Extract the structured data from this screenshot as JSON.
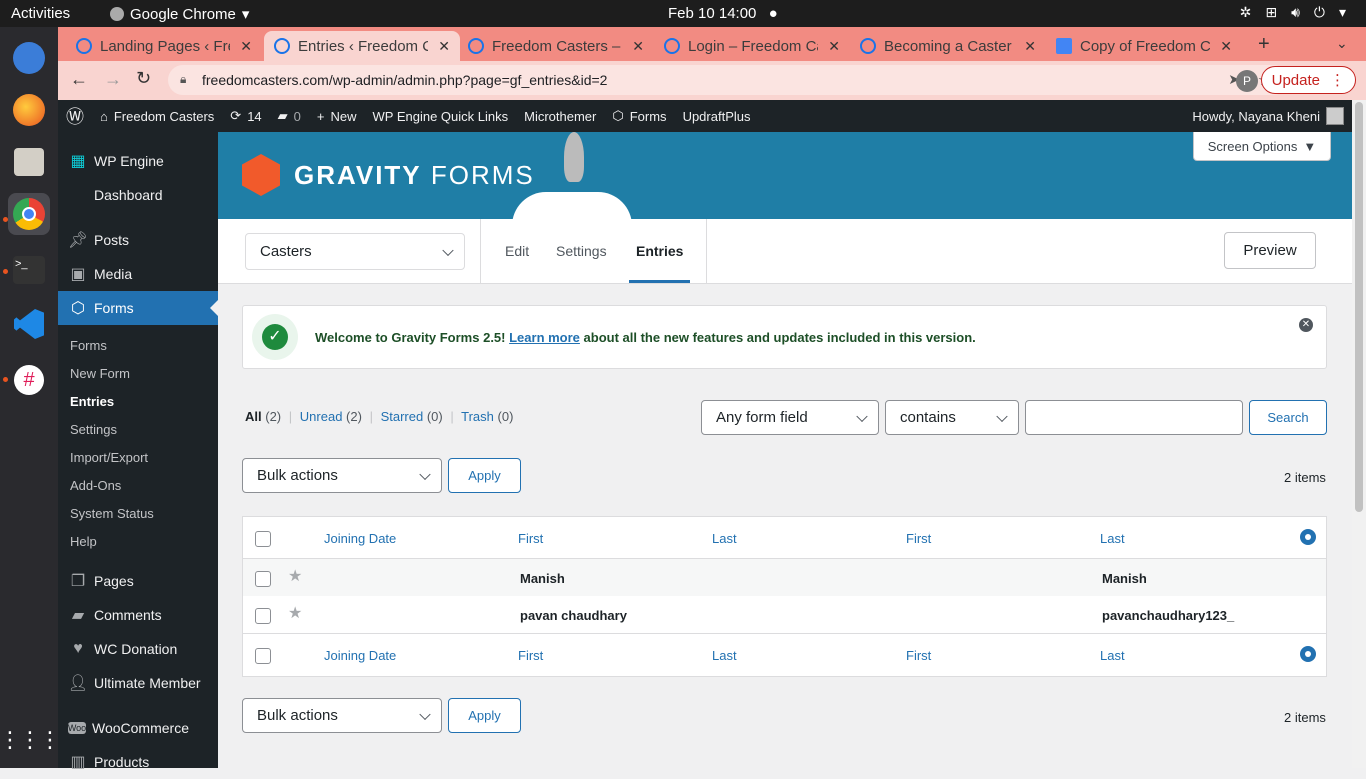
{
  "topbar": {
    "activities": "Activities",
    "app_name": "Google Chrome",
    "clock": "Feb 10  14:00"
  },
  "browser": {
    "tabs": [
      {
        "title": "Landing Pages ‹ Freedom Casters"
      },
      {
        "title": "Entries ‹ Freedom Casters"
      },
      {
        "title": "Freedom Casters – Freedom"
      },
      {
        "title": "Login – Freedom Casters"
      },
      {
        "title": "Becoming a Caster"
      },
      {
        "title": "Copy of Freedom Casters"
      }
    ],
    "url": "freedomcasters.com/wp-admin/admin.php?page=gf_entries&id=2",
    "profile_initial": "P",
    "update_label": "Update"
  },
  "adminbar": {
    "site_name": "Freedom Casters",
    "updates_count": "14",
    "comments_count": "0",
    "new_label": "New",
    "wpengine_links": "WP Engine Quick Links",
    "microthemer": "Microthemer",
    "forms": "Forms",
    "updraft": "UpdraftPlus",
    "howdy": "Howdy, Nayana Kheni"
  },
  "sidebar": {
    "wp_engine": "WP Engine",
    "dashboard": "Dashboard",
    "posts": "Posts",
    "media": "Media",
    "forms": "Forms",
    "sub_forms": "Forms",
    "new_form": "New Form",
    "entries": "Entries",
    "settings": "Settings",
    "import_export": "Import/Export",
    "addons": "Add-Ons",
    "system_status": "System Status",
    "help": "Help",
    "pages": "Pages",
    "comments": "Comments",
    "wc_donation": "WC Donation",
    "ultimate_member": "Ultimate Member",
    "woocommerce": "WooCommerce",
    "products": "Products"
  },
  "main": {
    "logo_text_bold": "GRAVITY",
    "logo_text_light": " FORMS",
    "screen_options": "Screen Options",
    "form_select": "Casters",
    "nav": {
      "edit": "Edit",
      "settings": "Settings",
      "entries": "Entries"
    },
    "preview": "Preview",
    "notice": {
      "prefix": "Welcome to Gravity Forms 2.5! ",
      "link": "Learn more",
      "suffix": " about all the new features and updates included in this version."
    },
    "filters": {
      "all": "All",
      "all_count": "(2)",
      "unread": "Unread",
      "unread_count": "(2)",
      "starred": "Starred",
      "starred_count": "(0)",
      "trash": "Trash",
      "trash_count": "(0)"
    },
    "search": {
      "field": "Any form field",
      "op": "contains",
      "value": "",
      "button": "Search"
    },
    "bulk_actions": "Bulk actions",
    "apply": "Apply",
    "items_count": "2 items",
    "columns": [
      "Joining Date",
      "First",
      "Last",
      "First",
      "Last"
    ],
    "rows": [
      {
        "first": "Manish",
        "last2": "Manish"
      },
      {
        "first": "pavan chaudhary",
        "last2": "pavanchaudhary123_"
      }
    ]
  }
}
